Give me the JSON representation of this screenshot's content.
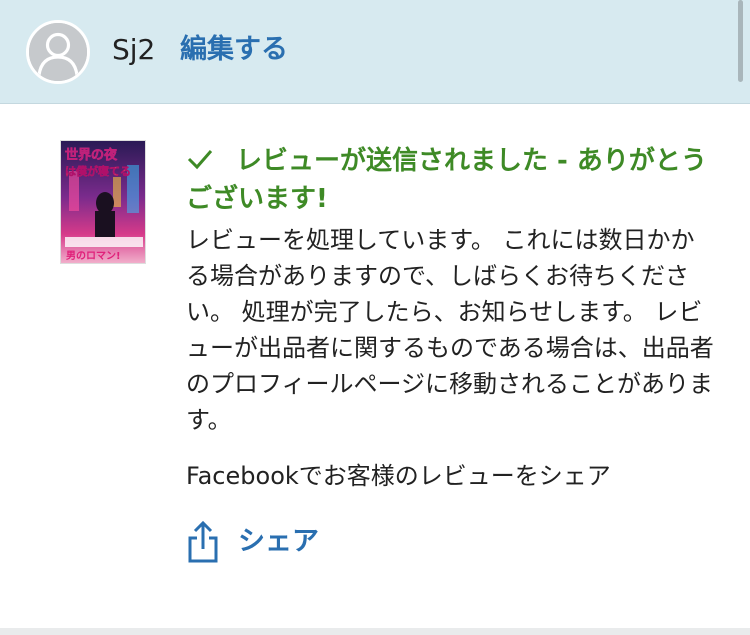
{
  "header": {
    "username": "Sj2",
    "edit_label": "編集する"
  },
  "book": {
    "cover_title": "世界の夜は僕が寝てる",
    "cover_tagline": "男のロマン!"
  },
  "review": {
    "success_title": "レビューが送信されました - ありがとうございます!",
    "message": "レビューを処理しています。 これには数日かかる場合がありますので、しばらくお待ちください。 処理が完了したら、お知らせします。 レビューが出品者に関するものである場合は、出品者のプロフィールページに移動されることがあります。",
    "share_prompt": "Facebookでお客様のレビューをシェア",
    "share_label": "シェア"
  },
  "colors": {
    "header_bg": "#d7eaf0",
    "success_green": "#3e8a26",
    "link_blue": "#2a6fb0"
  },
  "icons": {
    "avatar": "user-silhouette-icon",
    "check": "checkmark-icon",
    "share": "share-upload-icon"
  }
}
